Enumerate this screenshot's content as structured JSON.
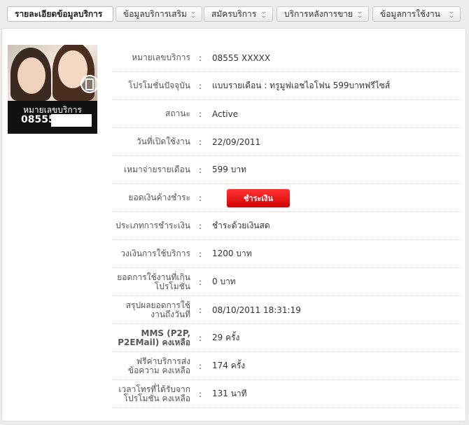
{
  "tabs": [
    {
      "label": "รายละเอียดข้อมูลบริการ",
      "active": true
    },
    {
      "label": "ข้อมูลบริการเสริม",
      "active": false
    },
    {
      "label": "สมัครบริการ",
      "active": false
    },
    {
      "label": "บริการหลังการขาย",
      "active": false
    },
    {
      "label": "ข้อมูลการใช้งาน",
      "active": false
    }
  ],
  "profile": {
    "caption": "หมายเลขบริการ",
    "number": "08555"
  },
  "details": [
    {
      "label": "หมายเลขบริการ",
      "value": "08555 XXXXX"
    },
    {
      "label": "โปรโมชั่นปัจจุบัน",
      "value": "แบบรายเดือน : ทรูมูฟเอชไอโฟน 599บาทฟรีไซส์"
    },
    {
      "label": "สถานะ",
      "value": "Active"
    },
    {
      "label": "วันที่เปิดใช้งาน",
      "value": "22/09/2011"
    },
    {
      "label": "เหมาจ่ายรายเดือน",
      "value": "599 บาท"
    },
    {
      "label": "ยอดเงินค้างชำระ",
      "button": "ชำระเงิน"
    },
    {
      "label": "ประเภทการชำระเงิน",
      "value": "ชำระด้วยเงินสด"
    },
    {
      "label": "วงเงินการใช้บริการ",
      "value": "1200 บาท"
    },
    {
      "label": "ยอดการใช้งานที่เกินโปรโมชั่น",
      "value": "0 บาท"
    },
    {
      "label": "สรุปผลยอดการใช้งานถึงวันที่",
      "value": "08/10/2011 18:31:19"
    },
    {
      "label": "MMS (P2P, P2EMail) คงเหลือ",
      "value": "29 ครั้ง"
    },
    {
      "label": "ฟรีค่าบริการส่งข้อความ คงเหลือ",
      "value": "174 ครั้ง"
    },
    {
      "label": "เวลาโทรที่ได้รับจากโปรโมชั่น คงเหลือ",
      "value": "131 นาที"
    }
  ],
  "colors": {
    "accent": "#e10000",
    "background": "#ececec"
  },
  "icons": [
    "chevron-double-down-icon",
    "mobile-phone-icon"
  ]
}
